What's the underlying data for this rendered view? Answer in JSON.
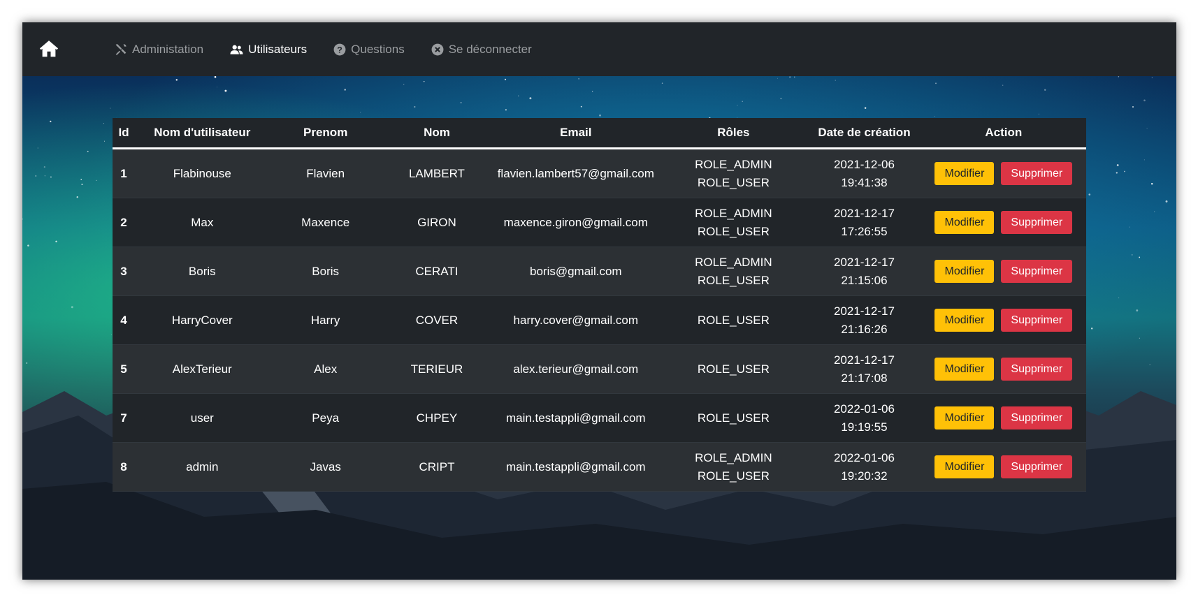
{
  "nav": {
    "items": [
      {
        "label": "Administation",
        "icon": "tools-icon",
        "active": false
      },
      {
        "label": "Utilisateurs",
        "icon": "users-icon",
        "active": true
      },
      {
        "label": "Questions",
        "icon": "question-circle-icon",
        "active": false
      },
      {
        "label": "Se déconnecter",
        "icon": "close-circle-icon",
        "active": false
      }
    ]
  },
  "table": {
    "headers": [
      "Id",
      "Nom d'utilisateur",
      "Prenom",
      "Nom",
      "Email",
      "Rôles",
      "Date de création",
      "Action"
    ],
    "rows": [
      {
        "id": "1",
        "username": "Flabinouse",
        "prenom": "Flavien",
        "nom": "LAMBERT",
        "email": "flavien.lambert57@gmail.com",
        "roles": "ROLE_ADMIN ROLE_USER",
        "date": "2021-12-06",
        "time": "19:41:38"
      },
      {
        "id": "2",
        "username": "Max",
        "prenom": "Maxence",
        "nom": "GIRON",
        "email": "maxence.giron@gmail.com",
        "roles": "ROLE_ADMIN ROLE_USER",
        "date": "2021-12-17",
        "time": "17:26:55"
      },
      {
        "id": "3",
        "username": "Boris",
        "prenom": "Boris",
        "nom": "CERATI",
        "email": "boris@gmail.com",
        "roles": "ROLE_ADMIN ROLE_USER",
        "date": "2021-12-17",
        "time": "21:15:06"
      },
      {
        "id": "4",
        "username": "HarryCover",
        "prenom": "Harry",
        "nom": "COVER",
        "email": "harry.cover@gmail.com",
        "roles": "ROLE_USER",
        "date": "2021-12-17",
        "time": "21:16:26"
      },
      {
        "id": "5",
        "username": "AlexTerieur",
        "prenom": "Alex",
        "nom": "TERIEUR",
        "email": "alex.terieur@gmail.com",
        "roles": "ROLE_USER",
        "date": "2021-12-17",
        "time": "21:17:08"
      },
      {
        "id": "7",
        "username": "user",
        "prenom": "Peya",
        "nom": "CHPEY",
        "email": "main.testappli@gmail.com",
        "roles": "ROLE_USER",
        "date": "2022-01-06",
        "time": "19:19:55"
      },
      {
        "id": "8",
        "username": "admin",
        "prenom": "Javas",
        "nom": "CRIPT",
        "email": "main.testappli@gmail.com",
        "roles": "ROLE_ADMIN ROLE_USER",
        "date": "2022-01-06",
        "time": "19:20:32"
      }
    ],
    "edit_label": "Modifier",
    "delete_label": "Supprimer"
  },
  "colors": {
    "navbar": "#212529",
    "table_dark": "#212529",
    "table_stripe": "#2c3034",
    "warning": "#ffc107",
    "danger": "#dc3545"
  }
}
